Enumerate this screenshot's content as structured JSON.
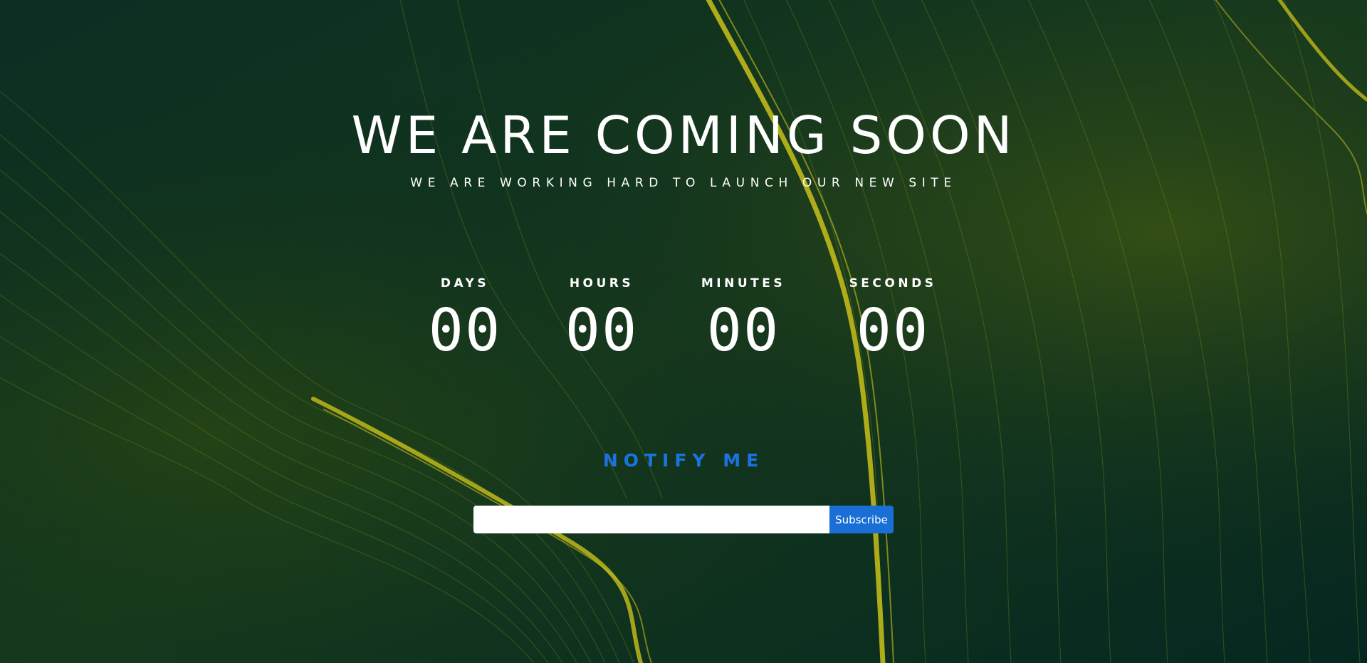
{
  "hero": {
    "title": "WE ARE COMING SOON",
    "subtitle": "WE ARE WORKING HARD TO LAUNCH OUR NEW SITE"
  },
  "countdown": {
    "days": {
      "label": "DAYS",
      "value": "00"
    },
    "hours": {
      "label": "HOURS",
      "value": "00"
    },
    "minutes": {
      "label": "MINUTES",
      "value": "00"
    },
    "seconds": {
      "label": "SECONDS",
      "value": "00"
    }
  },
  "notify": {
    "heading": "NOTIFY ME",
    "email_value": "",
    "email_placeholder": "",
    "subscribe_label": "Subscribe"
  },
  "colors": {
    "background": "#05251f",
    "accent_line": "#c9c11a",
    "notify_text": "#1a73e0",
    "button": "#1a6fd6"
  }
}
